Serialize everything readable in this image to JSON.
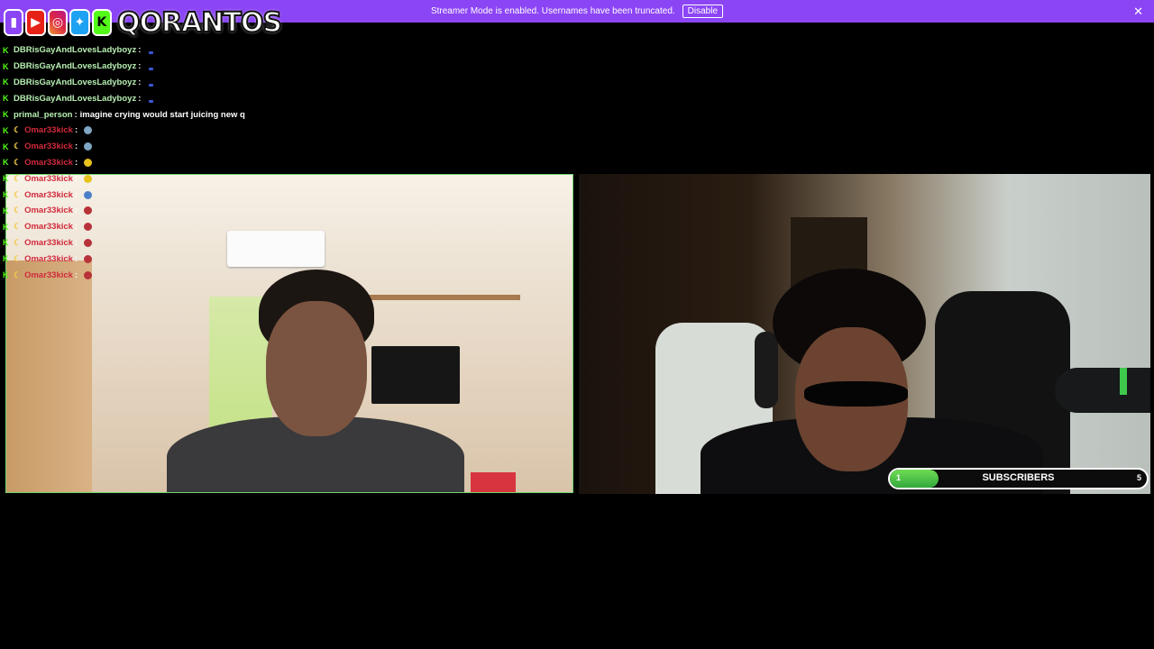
{
  "banner": {
    "text": "Streamer Mode is enabled. Usernames have been truncated.",
    "button_label": "Disable",
    "close_icon": "close-icon",
    "color": "#8c45f5"
  },
  "logo": {
    "icons": [
      "twitch-icon",
      "youtube-icon",
      "instagram-icon",
      "twitter-icon",
      "kick-icon"
    ],
    "name": "QORANTOS"
  },
  "chat": {
    "messages": [
      {
        "user": "DBRisGayAndLovesLadyboyz",
        "sep": ":",
        "text": ""
      },
      {
        "user": "DBRisGayAndLovesLadyboyz",
        "sep": ":",
        "text": ""
      },
      {
        "user": "DBRisGayAndLovesLadyboyz",
        "sep": ":",
        "text": ""
      },
      {
        "user": "DBRisGayAndLovesLadyboyz",
        "sep": ":",
        "text": ""
      },
      {
        "user": "primal_person",
        "sep": ":",
        "text": "imagine crying would start juicing new q"
      },
      {
        "user": "Omar33kick",
        "sep": ":",
        "text": ""
      },
      {
        "user": "Omar33kick",
        "sep": ":",
        "text": ""
      },
      {
        "user": "Omar33kick",
        "sep": ":",
        "text": ""
      },
      {
        "user": "Omar33kick",
        "sep": ":",
        "text": ""
      },
      {
        "user": "Omar33kick",
        "sep": ":",
        "text": ""
      },
      {
        "user": "Omar33kick",
        "sep": ":",
        "text": ""
      },
      {
        "user": "Omar33kick",
        "sep": ":",
        "text": ""
      },
      {
        "user": "Omar33kick",
        "sep": ":",
        "text": ""
      },
      {
        "user": "Omar33kick",
        "sep": ":",
        "text": ""
      },
      {
        "user": "Omar33kick",
        "sep": ":",
        "text": ""
      }
    ]
  },
  "subscribers": {
    "label": "SUBSCRIBERS",
    "current": "1",
    "goal": "5",
    "progress": 0.19
  }
}
